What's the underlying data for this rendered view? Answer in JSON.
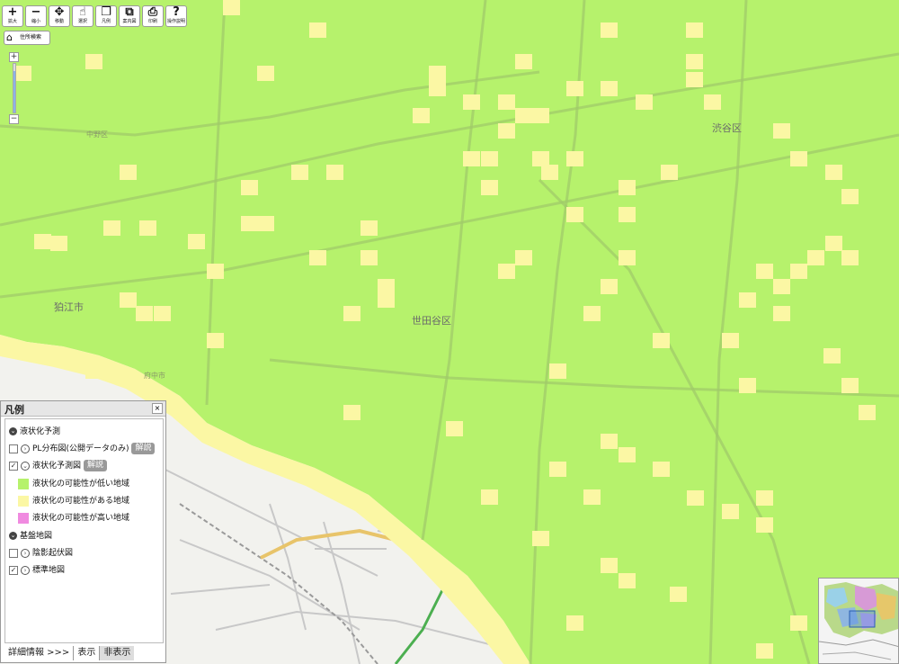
{
  "map": {
    "place_labels": [
      {
        "text": "世田谷区",
        "size": "big"
      },
      {
        "text": "渋谷区",
        "size": "big"
      },
      {
        "text": "狛江市",
        "size": "big"
      },
      {
        "text": "中野区",
        "size": "small"
      },
      {
        "text": "府中市",
        "size": "small"
      }
    ],
    "colors": {
      "low": "#b6f26c",
      "medium": "#fbf7a4",
      "high": "#f08ae0",
      "road": "#9fc96a",
      "base": "#f2f2ee"
    }
  },
  "toolbar": {
    "buttons": [
      {
        "icon": "+",
        "label": "拡大",
        "name": "zoom-in-button"
      },
      {
        "icon": "−",
        "label": "縮小",
        "name": "zoom-out-button"
      },
      {
        "icon": "✥",
        "label": "移動",
        "name": "pan-button"
      },
      {
        "icon": "☝",
        "label": "選択",
        "name": "select-button"
      },
      {
        "icon": "❐",
        "label": "凡例",
        "name": "legend-button"
      },
      {
        "icon": "⧉",
        "label": "案内図",
        "name": "guide-map-button"
      },
      {
        "icon": "⎙",
        "label": "印刷",
        "name": "print-button"
      },
      {
        "icon": "?",
        "label": "操作説明",
        "name": "help-button"
      }
    ],
    "address_search": "住所検索"
  },
  "zoom": {
    "plus": "+",
    "minus": "−",
    "level": 0.85
  },
  "legend": {
    "title": "凡例",
    "close": "×",
    "section1": "液状化予測",
    "pl_map": "PL分布図(公開データのみ)",
    "pl_checked": false,
    "explain1": "解説",
    "prediction_map": "液状化予測図",
    "prediction_checked": true,
    "explain2": "解説",
    "items": [
      {
        "label": "液状化の可能性が低い地域",
        "color": "#b6f26c"
      },
      {
        "label": "液状化の可能性がある地域",
        "color": "#fbf7a4"
      },
      {
        "label": "液状化の可能性が高い地域",
        "color": "#f08ae0"
      }
    ],
    "section2": "基盤地図",
    "relief": "陰影起伏図",
    "relief_checked": false,
    "standard": "標準地図",
    "standard_checked": true,
    "detail": "詳細情報 >>>",
    "show": "表示",
    "hide": "非表示"
  }
}
